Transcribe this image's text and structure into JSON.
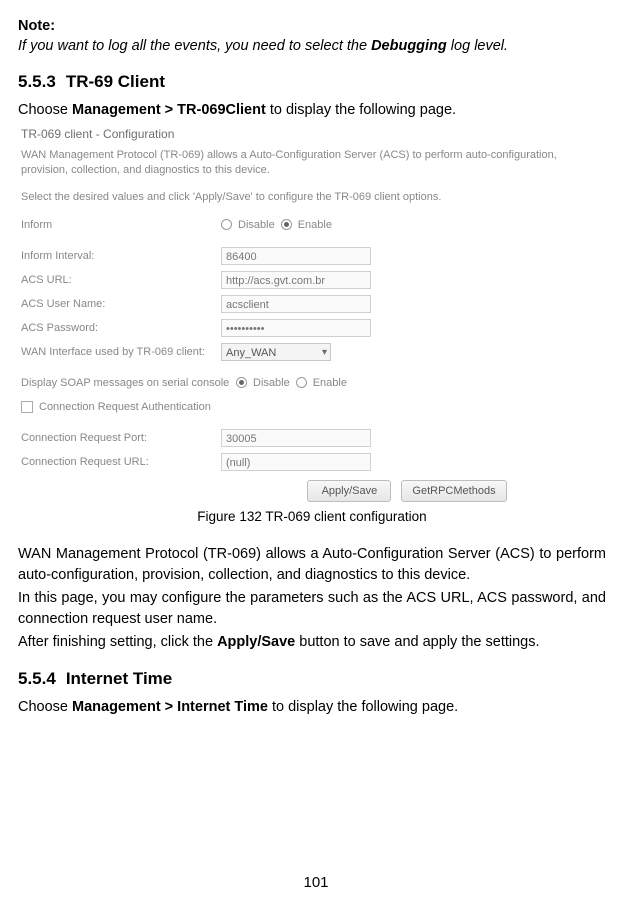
{
  "note": {
    "title": "Note:",
    "pre": "If you want to log all the events, you need to select the ",
    "bold": "Debugging",
    "post": " log level."
  },
  "section553": {
    "num": "5.5.3",
    "title": "TR-69 Client",
    "intro_pre": "Choose ",
    "intro_bold": "Management > TR-069Client",
    "intro_post": " to display the following page."
  },
  "panel": {
    "title": "TR-069 client - Configuration",
    "desc": "WAN Management Protocol (TR-069) allows a Auto-Configuration Server (ACS) to perform auto-configuration, provision, collection, and diagnostics to this device.",
    "hint": "Select the desired values and click 'Apply/Save' to configure the TR-069 client options.",
    "rows": {
      "inform": {
        "label": "Inform",
        "opt_disable": "Disable",
        "opt_enable": "Enable"
      },
      "interval": {
        "label": "Inform Interval:",
        "value": "86400"
      },
      "acs_url": {
        "label": "ACS URL:",
        "value": "http://acs.gvt.com.br"
      },
      "acs_user": {
        "label": "ACS User Name:",
        "value": "acsclient"
      },
      "acs_pass": {
        "label": "ACS Password:",
        "value": "••••••••••"
      },
      "wan_if": {
        "label": "WAN Interface used by TR-069 client:",
        "value": "Any_WAN"
      },
      "soap": {
        "label": "Display SOAP messages on serial console",
        "opt_disable": "Disable",
        "opt_enable": "Enable"
      },
      "conn_req_auth": {
        "label": "Connection Request Authentication"
      },
      "conn_req_port": {
        "label": "Connection Request Port:",
        "value": "30005"
      },
      "conn_req_url": {
        "label": "Connection Request URL:",
        "value": "(null)"
      }
    },
    "buttons": {
      "apply": "Apply/Save",
      "rpc": "GetRPCMethods"
    }
  },
  "figure_caption": "Figure 132 TR-069 client configuration",
  "paragraphs": {
    "p1": "WAN Management Protocol (TR-069) allows a Auto-Configuration Server (ACS) to perform auto-configuration, provision, collection, and diagnostics to this device.",
    "p2": "In this page, you may configure the parameters such as the ACS URL, ACS password, and connection request user name.",
    "p3_pre": "After finishing setting, click the ",
    "p3_bold": "Apply/Save",
    "p3_post": " button to save and apply the settings."
  },
  "section554": {
    "num": "5.5.4",
    "title": "Internet Time",
    "intro_pre": "Choose ",
    "intro_bold": "Management > Internet Time",
    "intro_post": " to display the following page."
  },
  "page_number": "101"
}
